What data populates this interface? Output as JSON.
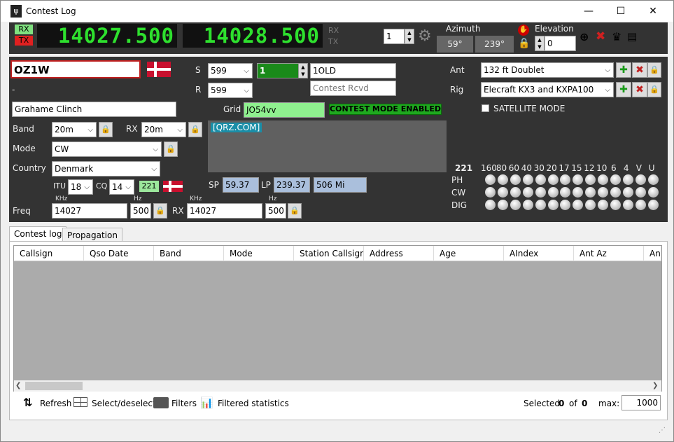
{
  "window": {
    "title": "Contest Log",
    "min": "—",
    "max": "☐",
    "close": "✕"
  },
  "radio": {
    "rx_label": "RX",
    "tx_label": "TX",
    "vfo_a": "14027.500",
    "vfo_b": "14028.500",
    "rx_label2": "RX",
    "tx_label2": "TX",
    "counter": "1",
    "azimuth_label": "Azimuth",
    "az_sp": "59°",
    "az_lp": "239°",
    "elevation_label": "Elevation",
    "elevation_value": "0"
  },
  "qso": {
    "callsign": "OZ1W",
    "dash": "-",
    "name": "Grahame Clinch",
    "band_label": "Band",
    "band": "20m",
    "rx_label": "RX",
    "rx_band": "20m",
    "mode_label": "Mode",
    "mode": "CW",
    "country_label": "Country",
    "country": "Denmark",
    "itu_label": "ITU",
    "itu": "18",
    "cq_label": "CQ",
    "cq": "14",
    "dxcc": "221",
    "freq_label": "Freq",
    "khz_label": "KHz",
    "freq": "14027",
    "hz_label": "Hz",
    "hz": "500",
    "rx_freq_label": "RX",
    "rx_khz_label": "KHz",
    "rx_freq": "14027",
    "rx_hz_label": "Hz",
    "rx_hz": "500",
    "s_label": "S",
    "rst_sent": "599",
    "r_label": "R",
    "rst_rcvd": "599",
    "serial": "1",
    "exchange_sent": "1OLD",
    "exchange_rcvd_placeholder": "Contest Rcvd",
    "grid_label": "Grid",
    "grid": "JO54vv",
    "contest_mode": "CONTEST MODE ENABLED",
    "qrz_link": "[QRZ.COM]",
    "sp_label": "SP",
    "sp": "59.37",
    "lp_label": "LP",
    "lp": "239.37",
    "distance": "506 Mi"
  },
  "station": {
    "ant_label": "Ant",
    "ant": "132 ft Doublet",
    "rig_label": "Rig",
    "rig": "Elecraft KX3 and KXPA100",
    "satellite_label": "SATELLITE MODE",
    "dxcc_number": "221",
    "bands": [
      "160",
      "80",
      "60",
      "40",
      "30",
      "20",
      "17",
      "15",
      "12",
      "10",
      "6",
      "4",
      "V",
      "U"
    ],
    "mode_rows": [
      "PH",
      "CW",
      "DIG"
    ]
  },
  "tabs": [
    "Contest log",
    "Propagation"
  ],
  "grid": {
    "columns": [
      "Callsign",
      "Qso Date",
      "Band",
      "Mode",
      "Station Callsign",
      "Address",
      "Age",
      "AIndex",
      "Ant Az",
      "Ant"
    ]
  },
  "statusbar": {
    "refresh": "Refresh",
    "select": "Select/deselect",
    "filters": "Filters",
    "stats": "Filtered statistics",
    "selected_label": "Selected",
    "selected": "0",
    "of_label": "of",
    "total": "0",
    "max_label": "max:",
    "max": "1000"
  },
  "colors": {
    "panel": "#333333",
    "led": "#2ee02e",
    "field_green": "#8ff08f",
    "contest_green": "#22aa22"
  }
}
